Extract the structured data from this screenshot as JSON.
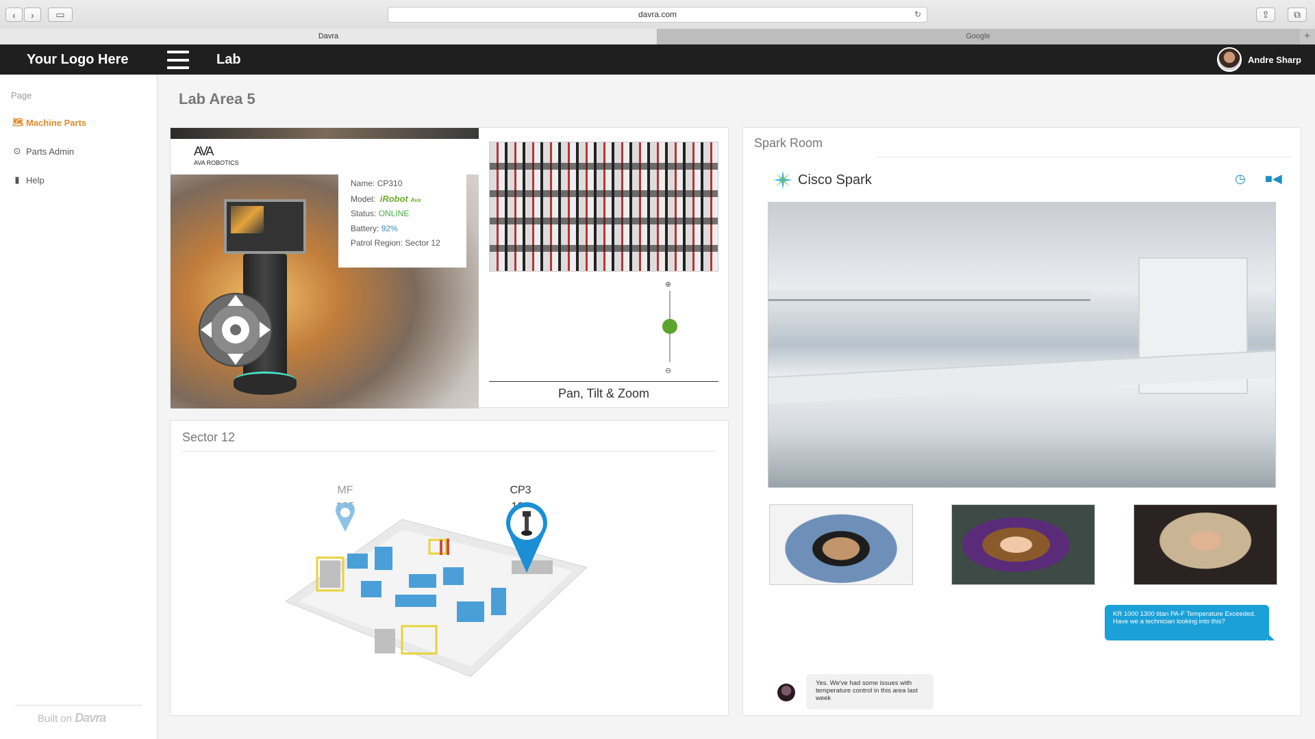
{
  "browser": {
    "url": "davra.com",
    "tabs": [
      {
        "label": "Davra",
        "active": true
      },
      {
        "label": "Google",
        "active": false
      }
    ],
    "new_tab": "+"
  },
  "header": {
    "logo": "Your Logo Here",
    "section": "Lab",
    "user_name": "Andre Sharp"
  },
  "sidebar": {
    "heading": "Page",
    "items": [
      {
        "label": "Machine Parts",
        "icon": "map-icon",
        "active": true
      },
      {
        "label": "Parts Admin",
        "icon": "target-icon",
        "active": false
      },
      {
        "label": "Help",
        "icon": "book-icon",
        "active": false
      }
    ],
    "footer_prefix": "Built on",
    "footer_brand": "Davra"
  },
  "main": {
    "title": "Lab Area 5",
    "robot": {
      "brand_mark": "AVA",
      "brand_text": "AVA ROBOTICS",
      "name_label": "Name:",
      "name": "CP310",
      "model_label": "Model:",
      "model_brand": "iRobot",
      "model_suffix": "Ava",
      "status_label": "Status:",
      "status": "ONLINE",
      "battery_label": "Battery:",
      "battery": "92%",
      "region_label": "Patrol Region:",
      "region": "Sector 12",
      "ptz_label": "Pan, Tilt & Zoom",
      "zoom_level": 0.5
    },
    "sector": {
      "title": "Sector 12",
      "markers": [
        {
          "label": "MF",
          "id": "135"
        },
        {
          "label": "CP3",
          "id": "102"
        }
      ]
    },
    "spark": {
      "title": "Spark Room",
      "brand": "Cisco Spark",
      "message_out": "KR 1000 1300 titan PA-F  Temperature Exceeded. Have we a technician looking into this?",
      "message_in": "Yes. We've  had some issues with temperature control in this area last week"
    }
  },
  "colors": {
    "accent_orange": "#e08a2c",
    "online_green": "#4aa84a",
    "spark_blue": "#1ba0d7",
    "header_dark": "#1f1f1f"
  }
}
